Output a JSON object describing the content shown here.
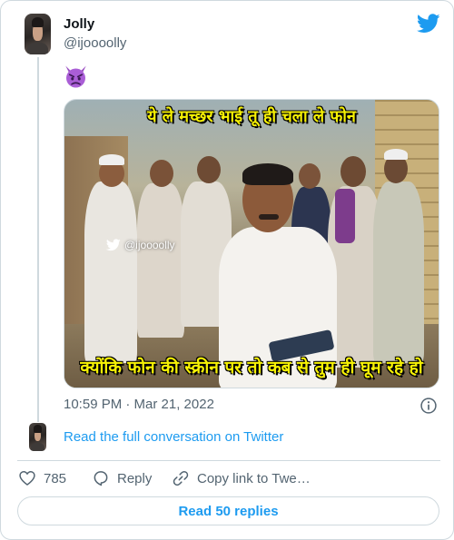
{
  "author": {
    "display_name": "Jolly",
    "handle": "@ijoooolly"
  },
  "tweet": {
    "emoji_icon": "angry-devil-face-icon",
    "media": {
      "caption_top": "ये ले मच्छर भाई तू ही चला ले फोन",
      "caption_bottom": "क्योंकि फोन की स्क्रीन पर तो कब से तुम ही घूम रहे हो",
      "watermark": "@ijoooolly"
    },
    "timestamp": "10:59 PM · Mar 21, 2022"
  },
  "links": {
    "read_conversation": "Read the full conversation on Twitter"
  },
  "actions": {
    "like_count": "785",
    "reply_label": "Reply",
    "copy_label": "Copy link to Twe…"
  },
  "footer": {
    "read_replies": "Read 50 replies"
  },
  "colors": {
    "brand": "#1d9bf0",
    "text_primary": "#0f1419",
    "text_secondary": "#536471",
    "border": "#cfd9de",
    "caption": "#f7f205"
  }
}
